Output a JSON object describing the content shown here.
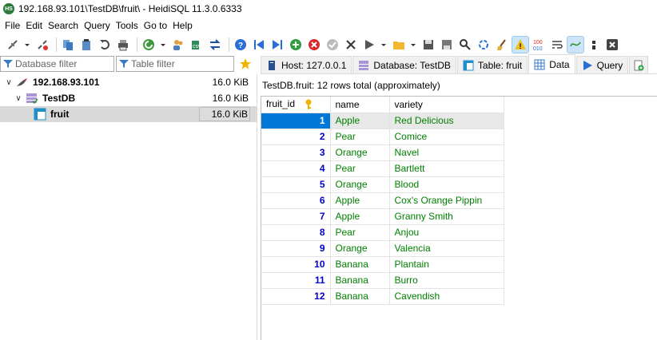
{
  "window": {
    "title": "192.168.93.101\\TestDB\\fruit\\ - HeidiSQL 11.3.0.6333",
    "app_icon_text": "HS"
  },
  "menu": [
    "File",
    "Edit",
    "Search",
    "Query",
    "Tools",
    "Go to",
    "Help"
  ],
  "filters": {
    "database_placeholder": "Database filter",
    "table_placeholder": "Table filter"
  },
  "tabs": [
    {
      "label": "Host: 127.0.0.1",
      "icon": "server-icon"
    },
    {
      "label": "Database: TestDB",
      "icon": "database-icon"
    },
    {
      "label": "Table: fruit",
      "icon": "table-icon"
    },
    {
      "label": "Data",
      "icon": "grid-icon",
      "active": true
    },
    {
      "label": "Query",
      "icon": "play-icon"
    }
  ],
  "tree": {
    "host": {
      "label": "192.168.93.101",
      "size": "16.0 KiB"
    },
    "database": {
      "label": "TestDB",
      "size": "16.0 KiB"
    },
    "table": {
      "label": "fruit",
      "size": "16.0 KiB"
    }
  },
  "data": {
    "status": "TestDB.fruit: 12 rows total (approximately)",
    "columns": [
      "fruit_id",
      "name",
      "variety"
    ],
    "rows": [
      [
        "1",
        "Apple",
        "Red Delicious"
      ],
      [
        "2",
        "Pear",
        "Comice"
      ],
      [
        "3",
        "Orange",
        "Navel"
      ],
      [
        "4",
        "Pear",
        "Bartlett"
      ],
      [
        "5",
        "Orange",
        "Blood"
      ],
      [
        "6",
        "Apple",
        "Cox's Orange Pippin"
      ],
      [
        "7",
        "Apple",
        "Granny Smith"
      ],
      [
        "8",
        "Pear",
        "Anjou"
      ],
      [
        "9",
        "Orange",
        "Valencia"
      ],
      [
        "10",
        "Banana",
        "Plantain"
      ],
      [
        "11",
        "Banana",
        "Burro"
      ],
      [
        "12",
        "Banana",
        "Cavendish"
      ]
    ]
  },
  "colors": {
    "selection": "#0078d7",
    "id_text": "#0000c8",
    "text_values": "#008000"
  }
}
